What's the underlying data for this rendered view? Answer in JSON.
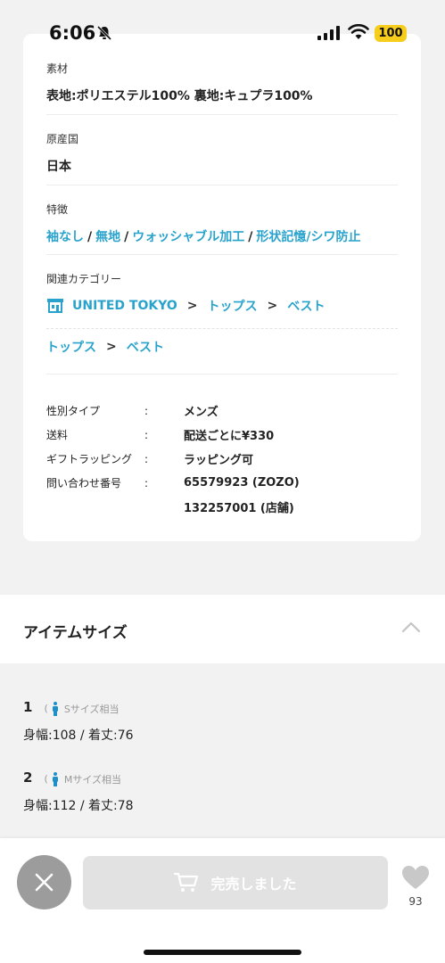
{
  "status_bar": {
    "time": "6:06",
    "battery": "100"
  },
  "details": {
    "material": {
      "label": "素材",
      "value": "表地:ポリエステル100% 裏地:キュプラ100%"
    },
    "origin": {
      "label": "原産国",
      "value": "日本"
    },
    "features": {
      "label": "特徴",
      "items": [
        "袖なし",
        "無地",
        "ウォッシャブル加工",
        "形状記憶/シワ防止"
      ],
      "separator": "/"
    },
    "category": {
      "label": "関連カテゴリー",
      "row1": [
        "UNITED TOKYO",
        "トップス",
        "ベスト"
      ],
      "row2": [
        "トップス",
        "ベスト"
      ],
      "separator": ">"
    },
    "specs": [
      {
        "key": "性別タイプ",
        "colon": ":",
        "value": "メンズ"
      },
      {
        "key": "送料",
        "colon": ":",
        "value": "配送ごとに¥330"
      },
      {
        "key": "ギフトラッピング",
        "colon": ":",
        "value": "ラッピング可"
      },
      {
        "key": "問い合わせ番号",
        "colon": ":",
        "value": "65579923 (ZOZO)"
      },
      {
        "key": "",
        "colon": "",
        "value": "132257001 (店舗)"
      }
    ]
  },
  "item_size": {
    "title": "アイテムサイズ",
    "sizes": [
      {
        "number": "1",
        "paren_open": "(",
        "note": "Sサイズ相当",
        "dims": "身幅:108 / 着丈:76"
      },
      {
        "number": "2",
        "paren_open": "(",
        "note": "Mサイズ相当",
        "dims": "身幅:112 / 着丈:78"
      }
    ]
  },
  "bottom_bar": {
    "soldout_label": "完売しました",
    "favorite_count": "93"
  },
  "colors": {
    "link": "#29a3cc",
    "battery": "#f5cd1a",
    "disabled_button": "#e2e2e2",
    "close_button": "#9c9c9c"
  },
  "icons": [
    "bell-slash-icon",
    "signal-icon",
    "wifi-icon",
    "shop-icon",
    "chevron-up-icon",
    "person-icon",
    "close-icon",
    "cart-icon",
    "heart-icon"
  ]
}
